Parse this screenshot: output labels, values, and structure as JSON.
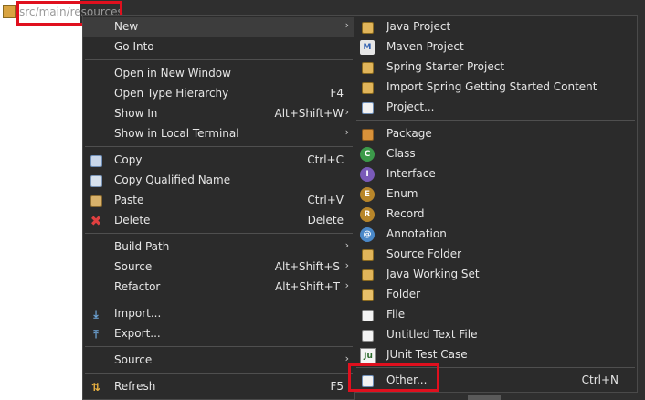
{
  "tree": {
    "path_label": "src/main/resources"
  },
  "context_menu": {
    "items": [
      {
        "label": "New",
        "shortcut": "",
        "submenu": true,
        "icon": ""
      },
      {
        "label": "Go Into",
        "shortcut": "",
        "submenu": false,
        "icon": ""
      },
      {
        "label": "Open in New Window",
        "shortcut": "",
        "submenu": false,
        "icon": ""
      },
      {
        "label": "Open Type Hierarchy",
        "shortcut": "F4",
        "submenu": false,
        "icon": ""
      },
      {
        "label": "Show In",
        "shortcut": "Alt+Shift+W",
        "submenu": true,
        "icon": ""
      },
      {
        "label": "Show in Local Terminal",
        "shortcut": "",
        "submenu": true,
        "icon": ""
      },
      {
        "label": "Copy",
        "shortcut": "Ctrl+C",
        "submenu": false,
        "icon": "copy-icon"
      },
      {
        "label": "Copy Qualified Name",
        "shortcut": "",
        "submenu": false,
        "icon": "copy-qualified-name-icon"
      },
      {
        "label": "Paste",
        "shortcut": "Ctrl+V",
        "submenu": false,
        "icon": "paste-icon"
      },
      {
        "label": "Delete",
        "shortcut": "Delete",
        "submenu": false,
        "icon": "delete-icon"
      },
      {
        "label": "Build Path",
        "shortcut": "",
        "submenu": true,
        "icon": ""
      },
      {
        "label": "Source",
        "shortcut": "Alt+Shift+S",
        "submenu": true,
        "icon": ""
      },
      {
        "label": "Refactor",
        "shortcut": "Alt+Shift+T",
        "submenu": true,
        "icon": ""
      },
      {
        "label": "Import...",
        "shortcut": "",
        "submenu": false,
        "icon": "import-icon"
      },
      {
        "label": "Export...",
        "shortcut": "",
        "submenu": false,
        "icon": "export-icon"
      },
      {
        "label": "Source",
        "shortcut": "",
        "submenu": true,
        "icon": ""
      },
      {
        "label": "Refresh",
        "shortcut": "F5",
        "submenu": false,
        "icon": "refresh-icon"
      }
    ]
  },
  "new_submenu": {
    "items": [
      {
        "label": "Java Project",
        "shortcut": "",
        "icon": "java-project-icon"
      },
      {
        "label": "Maven Project",
        "shortcut": "",
        "icon": "maven-project-icon"
      },
      {
        "label": "Spring Starter Project",
        "shortcut": "",
        "icon": "spring-starter-icon"
      },
      {
        "label": "Import Spring Getting Started Content",
        "shortcut": "",
        "icon": "spring-import-icon"
      },
      {
        "label": "Project...",
        "shortcut": "",
        "icon": "project-icon"
      },
      {
        "label": "Package",
        "shortcut": "",
        "icon": "package-icon"
      },
      {
        "label": "Class",
        "shortcut": "",
        "icon": "class-icon"
      },
      {
        "label": "Interface",
        "shortcut": "",
        "icon": "interface-icon"
      },
      {
        "label": "Enum",
        "shortcut": "",
        "icon": "enum-icon"
      },
      {
        "label": "Record",
        "shortcut": "",
        "icon": "record-icon"
      },
      {
        "label": "Annotation",
        "shortcut": "",
        "icon": "annotation-icon"
      },
      {
        "label": "Source Folder",
        "shortcut": "",
        "icon": "source-folder-icon"
      },
      {
        "label": "Java Working Set",
        "shortcut": "",
        "icon": "working-set-icon"
      },
      {
        "label": "Folder",
        "shortcut": "",
        "icon": "folder-icon"
      },
      {
        "label": "File",
        "shortcut": "",
        "icon": "file-icon"
      },
      {
        "label": "Untitled Text File",
        "shortcut": "",
        "icon": "text-file-icon"
      },
      {
        "label": "JUnit Test Case",
        "shortcut": "",
        "icon": "junit-icon"
      },
      {
        "label": "Other...",
        "shortcut": "Ctrl+N",
        "icon": "other-wizard-icon"
      }
    ]
  },
  "colors": {
    "highlight_box": "#e0101e",
    "menu_bg": "#2b2b2b",
    "selected_bg": "#3d3d3d"
  }
}
